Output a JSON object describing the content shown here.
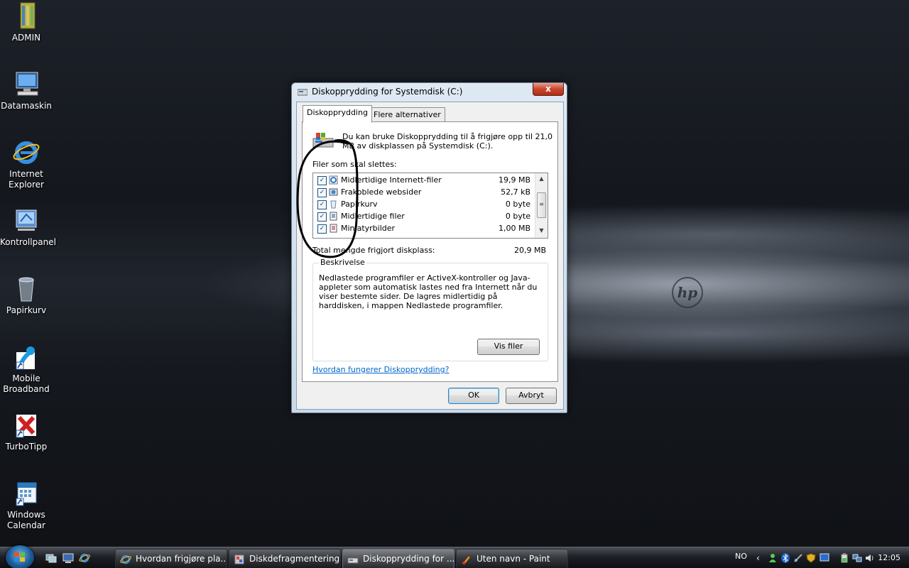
{
  "desktop": {
    "icons": [
      {
        "label": "ADMIN",
        "icon": "folder-icon"
      },
      {
        "label": "Datamaskin",
        "icon": "computer-icon"
      },
      {
        "label": "Internet Explorer",
        "icon": "ie-icon"
      },
      {
        "label": "Kontrollpanel",
        "icon": "control-panel-icon"
      },
      {
        "label": "Papirkurv",
        "icon": "recycle-bin-icon"
      },
      {
        "label": "Mobile Broadband",
        "icon": "mobile-broadband-icon"
      },
      {
        "label": "TurboTipp",
        "icon": "turbotipp-icon"
      },
      {
        "label": "Windows Calendar",
        "icon": "calendar-icon"
      }
    ],
    "wallpaper_logo": "hp"
  },
  "dialog": {
    "title": "Diskopprydding for Systemdisk (C:)",
    "close_label": "x",
    "tabs": [
      {
        "label": "Diskopprydding",
        "active": true
      },
      {
        "label": "Flere alternativer",
        "active": false
      }
    ],
    "info_text": "Du kan bruke Diskopprydding til å frigjøre opp til 21,0 MB av diskplassen på Systemdisk (C:).",
    "files_label": "Filer som skal slettes:",
    "files": [
      {
        "checked": true,
        "name": "Midlertidige Internett-filer",
        "size": "19,9 MB",
        "icon": "ie-files-icon"
      },
      {
        "checked": true,
        "name": "Frakoblede websider",
        "size": "52,7 kB",
        "icon": "offline-pages-icon"
      },
      {
        "checked": true,
        "name": "Papirkurv",
        "size": "0 byte",
        "icon": "recycle-bin-icon"
      },
      {
        "checked": true,
        "name": "Midlertidige filer",
        "size": "0 byte",
        "icon": "temp-files-icon"
      },
      {
        "checked": true,
        "name": "Miniatyrbilder",
        "size": "1,00 MB",
        "icon": "thumbnails-icon"
      }
    ],
    "total_label": "Total mengde frigjort diskplass:",
    "total_value": "20,9 MB",
    "description_legend": "Beskrivelse",
    "description_text": "Nedlastede programfiler er ActiveX-kontroller og Java-appleter som automatisk lastes ned fra Internett når du viser bestemte sider. De lagres midlertidig på harddisken, i mappen Nedlastede programfiler.",
    "view_files_label": "Vis filer",
    "help_link": "Hvordan fungerer Diskopprydding?",
    "ok_label": "OK",
    "cancel_label": "Avbryt"
  },
  "taskbar": {
    "tasks": [
      {
        "label": "Hvordan frigjøre pla...",
        "icon": "ie-icon",
        "active": false
      },
      {
        "label": "Diskdefragmentering",
        "icon": "defrag-icon",
        "active": false
      },
      {
        "label": "Diskopprydding for ...",
        "icon": "disk-cleanup-icon",
        "active": true
      },
      {
        "label": "Uten navn - Paint",
        "icon": "paint-icon",
        "active": false
      }
    ],
    "language": "NO",
    "clock": "12:05"
  }
}
